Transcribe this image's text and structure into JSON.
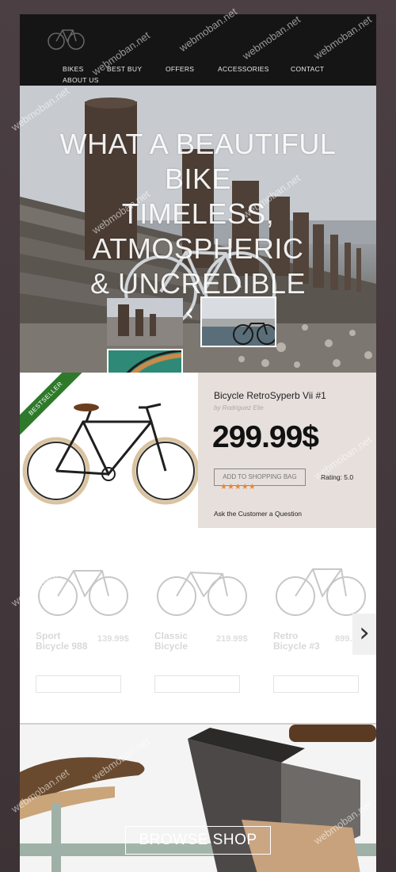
{
  "nav": {
    "items": [
      "BIKES",
      "BEST BUY",
      "OFFERS",
      "ACCESSORIES",
      "CONTACT",
      "ABOUT US"
    ]
  },
  "hero": {
    "heading_lines": [
      "WHAT A BEAUTIFUL",
      "BIKE",
      "TIMELESS,",
      "ATMOSPHERIC",
      "& UNCREDIBLE"
    ],
    "prev_arrow": "‹"
  },
  "featured": {
    "ribbon": "BESTSELLER",
    "name": "Bicycle RetroSyperb Vii #1",
    "by": "by Rodriguez Elie",
    "price": "299.99$",
    "add_to_bag": "ADD TO SHOPPING BAG",
    "rating_label": "Rating: 5.0",
    "stars": "★★★★★",
    "rating": 5,
    "ask_question": "Ask the Customer a Question"
  },
  "products": [
    {
      "name": "Sport Bicycle 988",
      "price": "139.99$"
    },
    {
      "name": "Classic Bicycle",
      "price": "219.99$"
    },
    {
      "name": "Retro Bicycle #3",
      "price": "899.99$"
    }
  ],
  "next_arrow": "›",
  "banner": {
    "button_label": "BROWSE SHOP"
  },
  "watermark": "webmoban.net",
  "colors": {
    "header_bg": "#151515",
    "ribbon_green": "#2e7a2a",
    "info_panel": "#e6dfdc",
    "star_orange": "#e58a3a"
  }
}
